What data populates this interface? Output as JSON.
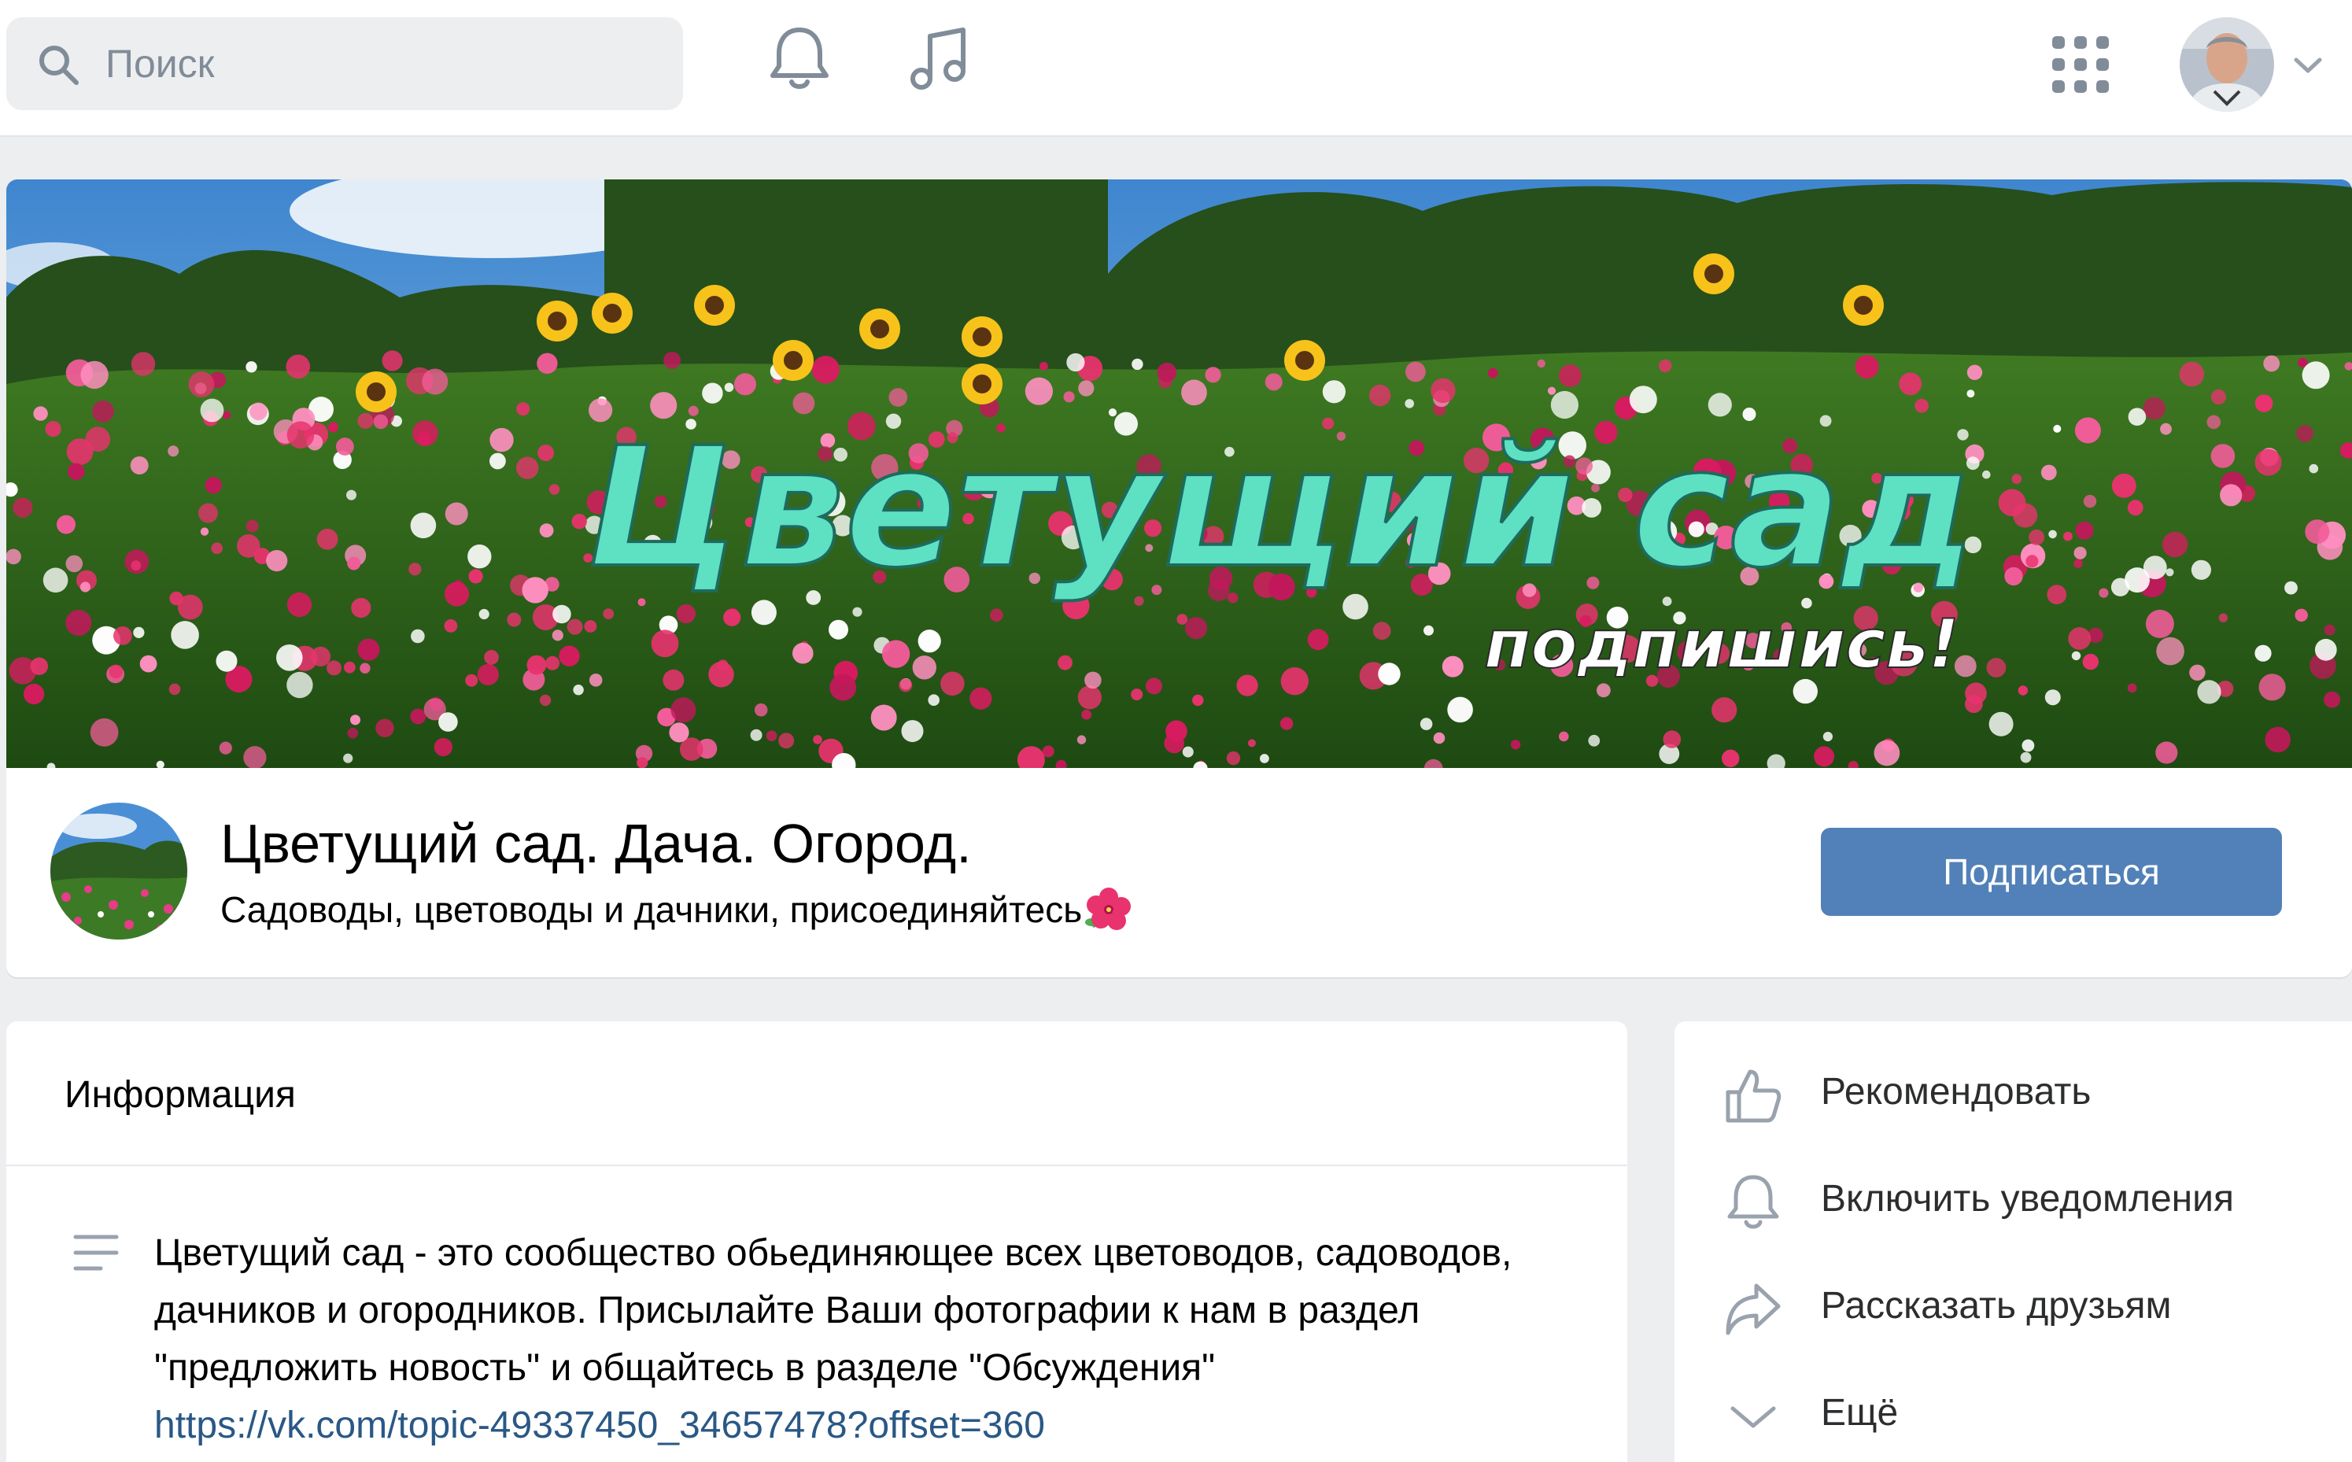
{
  "search": {
    "placeholder": "Поиск"
  },
  "topbar": {
    "notifications_icon": "bell-icon",
    "music_icon": "music-note-icon",
    "apps_icon": "grid-apps-icon",
    "profile_menu_icon": "chevron-down-icon"
  },
  "cover": {
    "title": "Цветущий сад",
    "subtitle": "подпишись!"
  },
  "community": {
    "name": "Цветущий сад. Дача. Огород.",
    "status": "Садоводы, цветоводы и дачники, присоединяйтесь",
    "status_emoji": "hibiscus-icon",
    "subscribe_label": "Подписаться"
  },
  "info": {
    "heading": "Информация",
    "description": "Цветущий сад - это сообщество обьединяющее всех цветоводов, садоводов, дачников и огородников. Присылайте Ваши фотографии к нам в раздел \"предложить новость\" и общайтесь в разделе \"Обсуждения\"",
    "link": "https://vk.com/topic-49337450_34657478?offset=360"
  },
  "actions": [
    {
      "label": "Рекомендовать",
      "icon": "thumbs-up-icon"
    },
    {
      "label": "Включить уведомления",
      "icon": "bell-icon"
    },
    {
      "label": "Рассказать друзьям",
      "icon": "share-arrow-icon"
    },
    {
      "label": "Ещё",
      "icon": "chevron-down-icon"
    }
  ],
  "colors": {
    "accent": "#5181b8",
    "link": "#2a5885",
    "background": "#edeef0",
    "icon": "#99a2ad",
    "cover_title": "#5ee0c3"
  }
}
